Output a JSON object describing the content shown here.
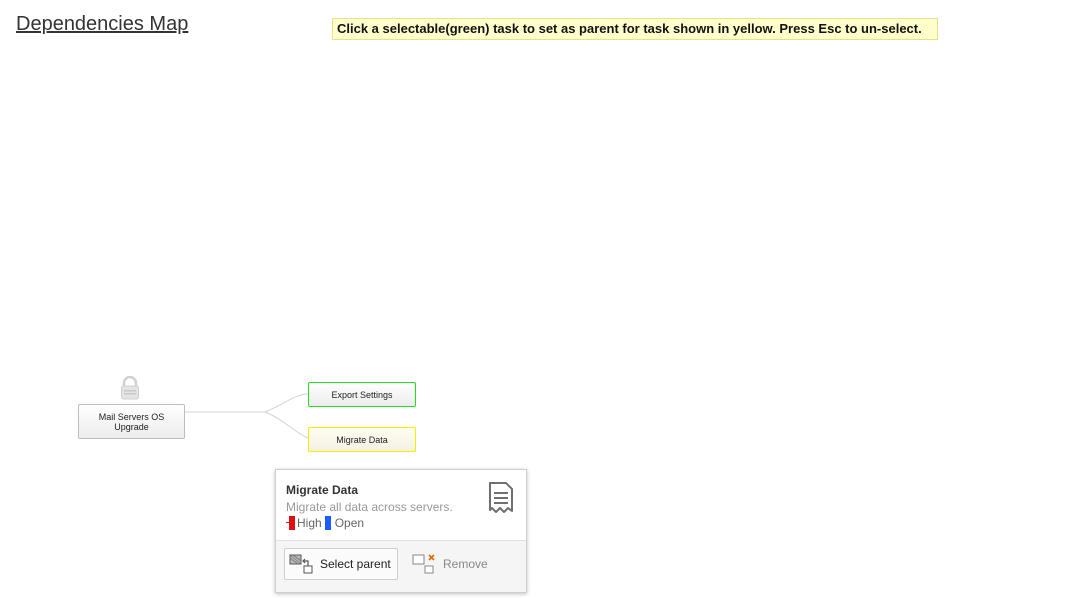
{
  "page": {
    "title": "Dependencies Map",
    "hint": "Click a selectable(green) task to set as parent for task shown in yellow. Press Esc to un-select."
  },
  "map": {
    "root_task": {
      "label": "Mail Servers OS Upgrade",
      "icon": "lock-icon"
    },
    "children": [
      {
        "label": "Export Settings",
        "state": "selectable",
        "border_color": "#22dd22"
      },
      {
        "label": "Migrate Data",
        "state": "current",
        "border_color": "#f5ee00"
      }
    ]
  },
  "popup": {
    "title": "Migrate Data",
    "description": "Migrate all data across servers.",
    "priority": "High",
    "priority_color": "#e01010",
    "status": "Open",
    "status_color": "#1a5cff",
    "icon": "document-icon",
    "actions": {
      "select_parent": "Select parent",
      "remove": "Remove"
    }
  }
}
